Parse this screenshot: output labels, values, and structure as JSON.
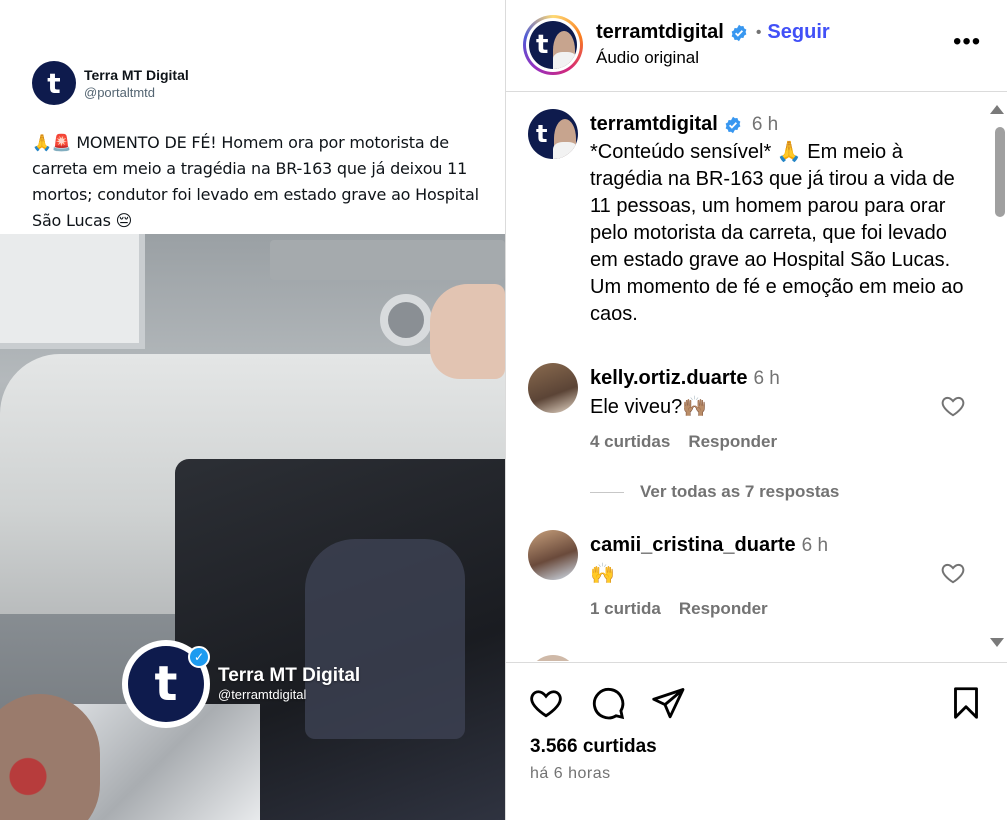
{
  "media": {
    "tweet": {
      "name": "Terra MT Digital",
      "handle": "@portaltmtd",
      "text": "🙏🚨 MOMENTO DE FÉ! Homem ora por motorista de carreta em meio a tragédia na BR-163 que já deixou 11 mortos; condutor foi levado em estado grave ao Hospital São Lucas 😔"
    },
    "watermark": {
      "name": "Terra MT Digital",
      "handle": "@terramtdigital"
    }
  },
  "header": {
    "username": "terramtdigital",
    "separator": "•",
    "follow_label": "Seguir",
    "audio": "Áudio original",
    "more": "•••"
  },
  "caption": {
    "username": "terramtdigital",
    "time": "6 h",
    "text": "*Conteúdo sensível* 🙏 Em meio à tragédia na BR-163 que já tirou a vida de 11 pessoas, um homem parou para orar pelo motorista da carreta, que foi levado em estado grave ao Hospital São Lucas. Um momento de fé e emoção em meio ao caos."
  },
  "comments": [
    {
      "username": "kelly.ortiz.duarte",
      "time": "6 h",
      "text": "Ele viveu?🙌🏽",
      "likes": "4 curtidas",
      "reply": "Responder"
    },
    {
      "username": "camii_cristina_duarte",
      "time": "6 h",
      "text": "🙌",
      "likes": "1 curtida",
      "reply": "Responder"
    }
  ],
  "view_replies": "Ver todas as 7 respostas",
  "footer": {
    "likes": "3.566 curtidas",
    "time_ago": "há 6 horas"
  },
  "colors": {
    "follow": "#4150f7",
    "verified": "#3897f0",
    "muted": "#737373",
    "brand_navy": "#0e1b4d"
  }
}
